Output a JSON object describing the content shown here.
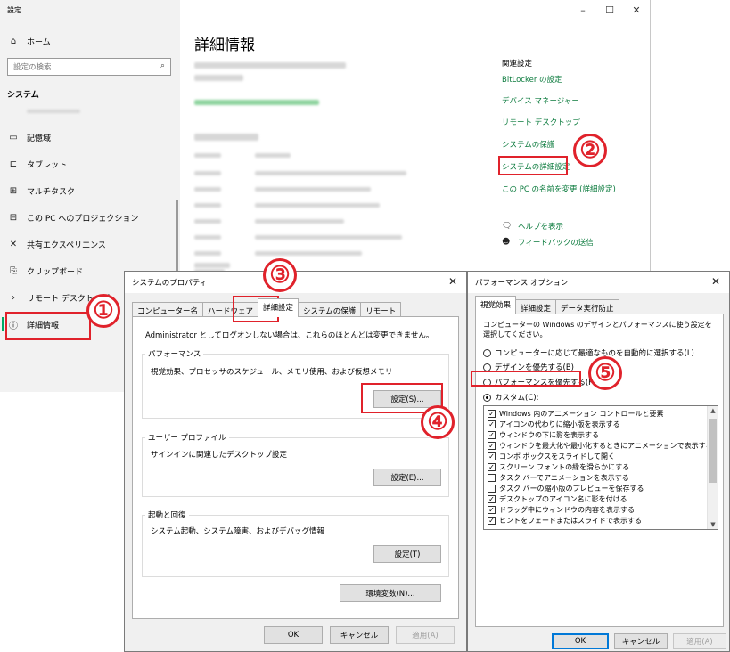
{
  "settings": {
    "title": "設定",
    "window_controls": {
      "minimize": "–",
      "maximize": "☐",
      "close": "✕"
    },
    "sidebar": {
      "home": "ホーム",
      "search_placeholder": "設定の検索",
      "section": "システム",
      "items": [
        {
          "label": "記憶域",
          "icon": "storage-icon"
        },
        {
          "label": "タブレット",
          "icon": "tablet-icon"
        },
        {
          "label": "マルチタスク",
          "icon": "multitask-icon"
        },
        {
          "label": "この PC へのプロジェクション",
          "icon": "projection-icon"
        },
        {
          "label": "共有エクスペリエンス",
          "icon": "shared-experience-icon"
        },
        {
          "label": "クリップボード",
          "icon": "clipboard-icon"
        },
        {
          "label": "リモート デスクトップ",
          "icon": "remote-desktop-icon"
        },
        {
          "label": "詳細情報",
          "icon": "info-icon"
        }
      ]
    },
    "main": {
      "title": "詳細情報",
      "related_heading": "関連設定",
      "related_links": [
        "BitLocker の設定",
        "デバイス マネージャー",
        "リモート デスクトップ",
        "システムの保護",
        "システムの詳細設定",
        "この PC の名前を変更 (詳細設定)"
      ],
      "help": "ヘルプを表示",
      "feedback": "フィードバックの送信"
    }
  },
  "sysprops": {
    "title": "システムのプロパティ",
    "close": "✕",
    "tabs": [
      "コンピューター名",
      "ハードウェア",
      "詳細設定",
      "システムの保護",
      "リモート"
    ],
    "selected_tab": "詳細設定",
    "admin_note": "Administrator としてログオンしない場合は、これらのほとんどは変更できません。",
    "performance": {
      "label": "パフォーマンス",
      "desc": "視覚効果、プロセッサのスケジュール、メモリ使用、および仮想メモリ",
      "button": "設定(S)..."
    },
    "profile": {
      "label": "ユーザー プロファイル",
      "desc": "サインインに関連したデスクトップ設定",
      "button": "設定(E)..."
    },
    "startup": {
      "label": "起動と回復",
      "desc": "システム起動、システム障害、およびデバッグ情報",
      "button": "設定(T)"
    },
    "env_button": "環境変数(N)...",
    "ok": "OK",
    "cancel": "キャンセル",
    "apply": "適用(A)"
  },
  "perf": {
    "title": "パフォーマンス オプション",
    "close": "✕",
    "tabs": [
      "視覚効果",
      "詳細設定",
      "データ実行防止"
    ],
    "selected_tab": "視覚効果",
    "desc": "コンピューターの Windows のデザインとパフォーマンスに使う設定を選択してください。",
    "radios": [
      {
        "label": "コンピューターに応じて最適なものを自動的に選択する(L)",
        "checked": false
      },
      {
        "label": "デザインを優先する(B)",
        "checked": false
      },
      {
        "label": "パフォーマンスを優先する(P)",
        "checked": false
      },
      {
        "label": "カスタム(C):",
        "checked": true
      }
    ],
    "effects": [
      {
        "label": "Windows 内のアニメーション コントロールと要素",
        "checked": true
      },
      {
        "label": "アイコンの代わりに縮小版を表示する",
        "checked": true
      },
      {
        "label": "ウィンドウの下に影を表示する",
        "checked": true
      },
      {
        "label": "ウィンドウを最大化や最小化するときにアニメーションで表示する",
        "checked": true
      },
      {
        "label": "コンボ ボックスをスライドして開く",
        "checked": true
      },
      {
        "label": "スクリーン フォントの縁を滑らかにする",
        "checked": true
      },
      {
        "label": "タスク バーでアニメーションを表示する",
        "checked": false
      },
      {
        "label": "タスク バーの縮小版のプレビューを保存する",
        "checked": false
      },
      {
        "label": "デスクトップのアイコン名に影を付ける",
        "checked": true
      },
      {
        "label": "ドラッグ中にウィンドウの内容を表示する",
        "checked": true
      },
      {
        "label": "ヒントをフェードまたはスライドで表示する",
        "checked": true
      }
    ],
    "ok": "OK",
    "cancel": "キャンセル",
    "apply": "適用(A)"
  },
  "badges": [
    "①",
    "②",
    "③",
    "④",
    "⑤"
  ],
  "colors": {
    "link": "#0a7a3c",
    "highlight": "#e0222b",
    "focus": "#0078d7"
  }
}
